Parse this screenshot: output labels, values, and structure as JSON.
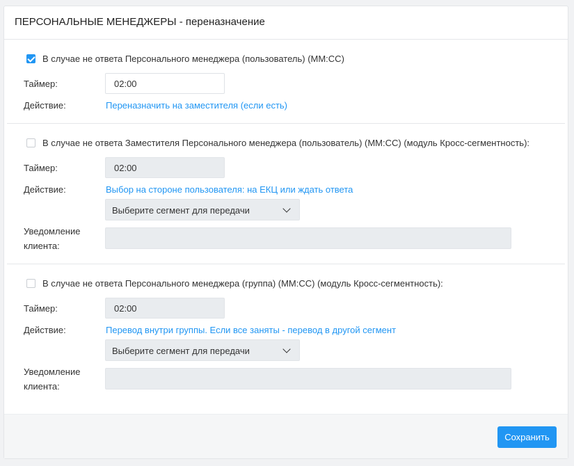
{
  "header": {
    "title": "ПЕРСОНАЛЬНЫЕ МЕНЕДЖЕРЫ - переназначение"
  },
  "sections": [
    {
      "checked": true,
      "title": "В случае не ответа Персонального менеджера (пользователь) (ММ:СС)",
      "timer_label": "Таймер:",
      "timer_value": "02:00",
      "action_label": "Действие:",
      "action_value": "Переназначить на заместителя (если есть)"
    },
    {
      "checked": false,
      "title": "В случае не ответа Заместителя Персонального менеджера (пользователь) (ММ:СС) (модуль Кросс-сегментность):",
      "timer_label": "Таймер:",
      "timer_value": "02:00",
      "action_label": "Действие:",
      "action_value": "Выбор на стороне пользователя: на ЕКЦ или ждать ответа",
      "segment_select": "Выберите сегмент для передачи",
      "notify_label_1": "Уведомление",
      "notify_label_2": "клиента:",
      "notify_value": ""
    },
    {
      "checked": false,
      "title": "В случае не ответа Персонального менеджера (группа) (ММ:СС) (модуль Кросс-сегментность):",
      "timer_label": "Таймер:",
      "timer_value": "02:00",
      "action_label": "Действие:",
      "action_value": "Перевод внутри группы. Если все заняты - перевод в другой сегмент",
      "segment_select": "Выберите сегмент для передачи",
      "notify_label_1": "Уведомление",
      "notify_label_2": "клиента:",
      "notify_value": ""
    }
  ],
  "footer": {
    "save_label": "Сохранить"
  },
  "colors": {
    "accent": "#2196f3",
    "disabled_bg": "#e9ecef"
  }
}
